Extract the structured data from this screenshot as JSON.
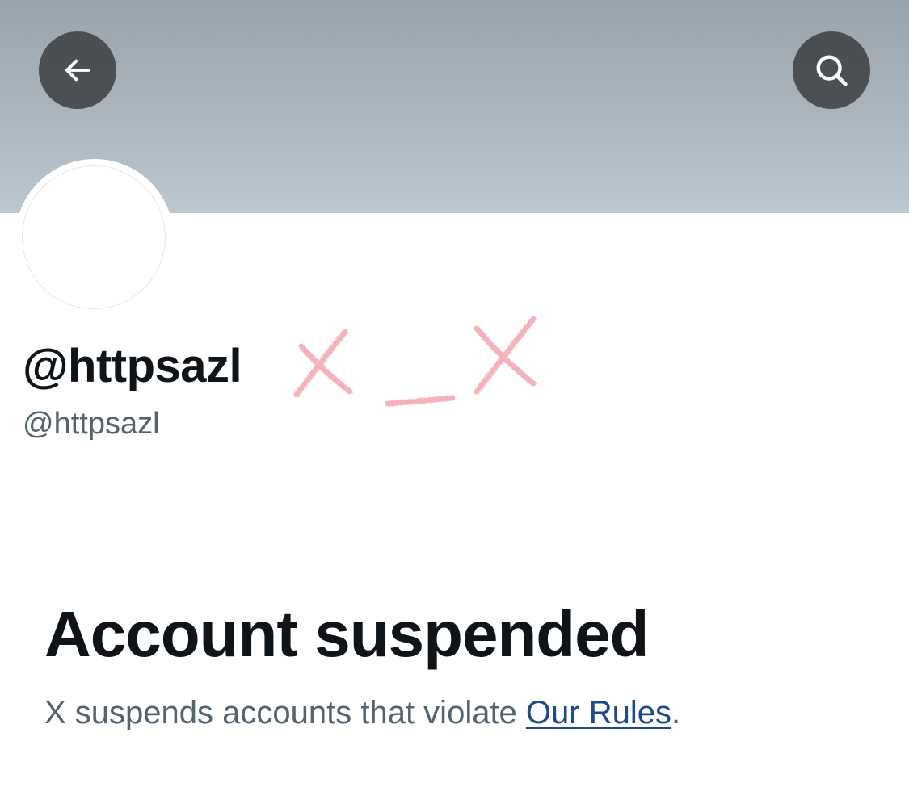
{
  "header": {
    "back_icon": "arrow-left-icon",
    "search_icon": "search-icon",
    "banner_color": "#a9b4bd",
    "button_color": "#3a3d41"
  },
  "profile": {
    "display_name": "@httpsazl",
    "handle": "@httpsazl",
    "doodle_color": "#f4a5b0"
  },
  "suspension": {
    "title": "Account suspended",
    "message_prefix": "X suspends accounts that violate ",
    "link_text": "Our Rules",
    "message_suffix": "."
  },
  "colors": {
    "text_primary": "#0f1419",
    "text_secondary": "#536471",
    "link": "#1d4a8a"
  }
}
